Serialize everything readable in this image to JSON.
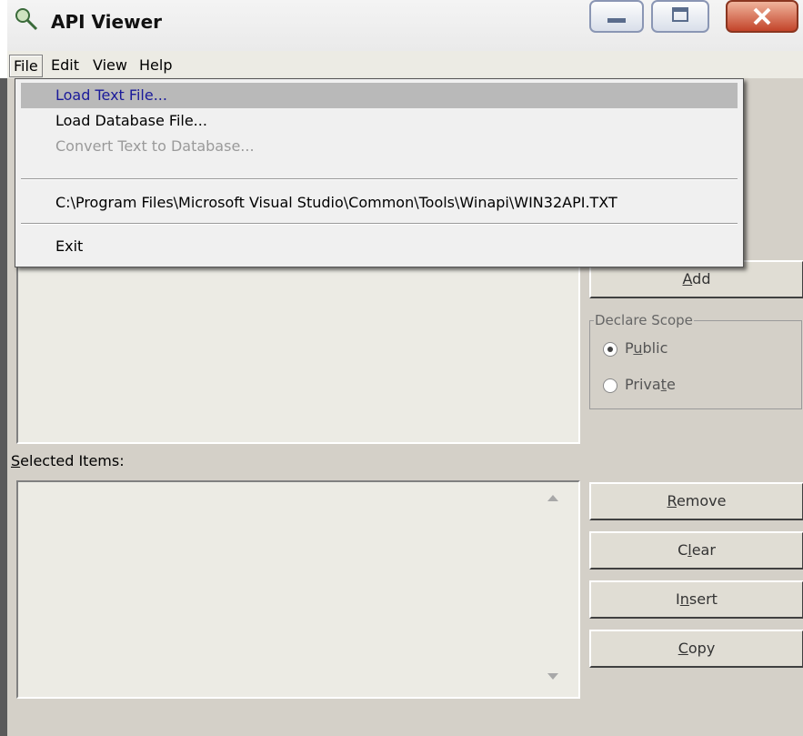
{
  "window": {
    "title": "API Viewer"
  },
  "menubar": {
    "file": "File",
    "edit": "Edit",
    "view": "View",
    "help": "Help"
  },
  "file_menu": {
    "load_text": "Load Text File...",
    "load_db": "Load Database File...",
    "convert": "Convert Text to Database...",
    "recent": "C:\\Program Files\\Microsoft Visual Studio\\Common\\Tools\\Winapi\\WIN32API.TXT",
    "exit": "Exit"
  },
  "buttons": {
    "add": {
      "before": "",
      "key": "A",
      "after": "dd"
    },
    "remove": {
      "before": "",
      "key": "R",
      "after": "emove"
    },
    "clear": {
      "before": "C",
      "key": "l",
      "after": "ear"
    },
    "insert": {
      "before": "I",
      "key": "n",
      "after": "sert"
    },
    "copy": {
      "before": "",
      "key": "C",
      "after": "opy"
    }
  },
  "declare_scope": {
    "label": "Declare Scope",
    "public": {
      "before": "P",
      "key": "u",
      "after": "blic",
      "selected": true
    },
    "private": {
      "before": "Priva",
      "key": "t",
      "after": "e",
      "selected": false
    }
  },
  "selected_items": {
    "key": "S",
    "after": "elected Items:"
  },
  "colors": {
    "menu_highlight": "#b9b9b9",
    "highlight_text": "#1a1a9a",
    "face": "#d4d0c8"
  }
}
